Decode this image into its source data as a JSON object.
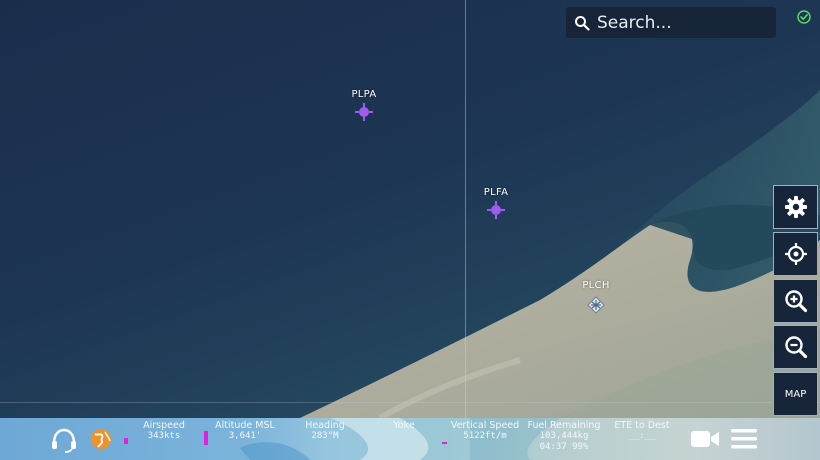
{
  "search": {
    "placeholder": "Search..."
  },
  "waypoints": [
    {
      "id": "PLPA",
      "label": "PLPA",
      "kind": "waypoint"
    },
    {
      "id": "PLFA",
      "label": "PLFA",
      "kind": "waypoint"
    },
    {
      "id": "PLCH",
      "label": "PLCH",
      "kind": "airport"
    }
  ],
  "side_controls": {
    "settings": "gear-icon",
    "recenter": "crosshair-icon",
    "zoom_in": "zoom-in-icon",
    "zoom_out": "zoom-out-icon",
    "map_label": "MAP"
  },
  "bottom_bar": {
    "airspeed": {
      "label": "Airspeed",
      "value": "343kts"
    },
    "altitude": {
      "label": "Altitude MSL",
      "value": "3,641'"
    },
    "heading": {
      "label": "Heading",
      "value": "283°M"
    },
    "yoke": {
      "label": "Yoke",
      "value": ""
    },
    "vertical_speed": {
      "label": "Vertical Speed",
      "value": "5122ft/m"
    },
    "fuel": {
      "label": "Fuel Remaining",
      "value": "103,444kg",
      "value2": "04:37 99%"
    },
    "ete": {
      "label": "ETE to Dest",
      "value": "__:__"
    }
  },
  "colors": {
    "waypoint": "#a05cf0",
    "indicator": "#e020e0",
    "globe": "#f0922a",
    "status_ok": "#5fd35f"
  }
}
